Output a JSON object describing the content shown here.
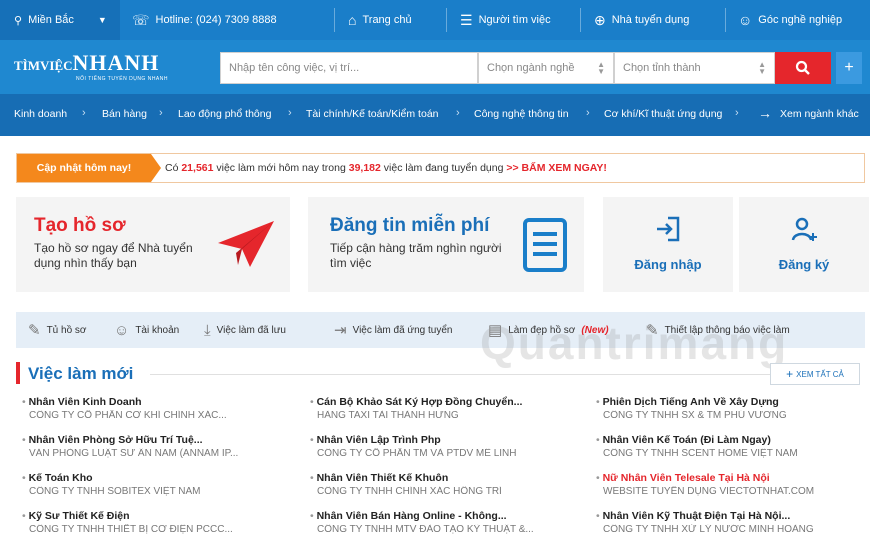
{
  "topbar": {
    "region": "Miền Bắc",
    "hotline": "Hotline: (024) 7309 8888",
    "home": "Trang chủ",
    "jobseeker": "Người tìm việc",
    "employer": "Nhà tuyển dụng",
    "career": "Góc nghề nghiệp"
  },
  "logo": {
    "text_a": "TÌMVIỆC",
    "text_b": "NHANH",
    "tagline": "NỐI TIẾNG TUYỂN DỤNG NHANH"
  },
  "search": {
    "keyword_placeholder": "Nhập tên công việc, vị trí...",
    "industry_placeholder": "Chọn ngành nghề",
    "city_placeholder": "Chọn tỉnh thành"
  },
  "categories": [
    "Kinh doanh",
    "Bán hàng",
    "Lao động phổ thông",
    "Tài chính/Kế toán/Kiểm toán",
    "Công nghệ thông tin",
    "Cơ khí/Kĩ thuật ứng dụng"
  ],
  "more_categories": "Xem ngành khác",
  "banner": {
    "tag": "Cập nhật hôm nay!",
    "t1": "Có ",
    "new_jobs": "21,561",
    "t2": " việc làm mới hôm nay trong ",
    "total_jobs": "39,182",
    "t3": " việc làm đang tuyển dụng ",
    "cta": ">> BẤM XEM NGAY!"
  },
  "cards": {
    "cv_title": "Tạo hồ sơ",
    "cv_sub": "Tạo hồ sơ ngay để Nhà tuyển dụng nhìn thấy bạn",
    "post_title": "Đăng tin miễn phí",
    "post_sub": "Tiếp cận hàng trăm nghìn người tìm việc",
    "login": "Đăng nhập",
    "register": "Đăng ký"
  },
  "tools": {
    "my_cv": "Tủ hồ sơ",
    "account": "Tài khoản",
    "saved": "Việc làm đã lưu",
    "applied": "Việc làm đã ứng tuyển",
    "beautify": "Làm đẹp hồ sơ",
    "beautify_new": "(New)",
    "alerts": "Thiết lập thông báo việc làm"
  },
  "watermark": "Quantrimang",
  "jobs_section": {
    "title": "Việc làm mới",
    "view_all": "XEM TẤT CẢ",
    "jobs": [
      {
        "title": "Nhân Viên Kinh Doanh",
        "company": "CÔNG TY CỔ PHẦN CƠ KHÍ CHÍNH XÁC..."
      },
      {
        "title": "Cán Bộ Khảo Sát Ký Hợp Đồng Chuyển...",
        "company": "HÃNG TAXI TÀI THÀNH HƯNG"
      },
      {
        "title": "Phiên Dịch Tiếng Anh Về Xây Dựng",
        "company": "CÔNG TY TNHH SX & TM PHÚ VƯƠNG"
      },
      {
        "title": "Nhân Viên Phòng Sở Hữu Trí Tuệ...",
        "company": "VĂN PHÒNG LUẬT SƯ ÂN NAM (ANNAM IP..."
      },
      {
        "title": "Nhân Viên Lập Trình Php",
        "company": "CÔNG TY CỔ PHẦN TM VÀ PTDV MÊ LINH"
      },
      {
        "title": "Nhân Viên Kế Toán (Đi Làm Ngay)",
        "company": "CÔNG TY TNHH SCENT HOME VIỆT NAM"
      },
      {
        "title": "Kế Toán Kho",
        "company": "CÔNG TY TNHH SOBITEX VIỆT NAM"
      },
      {
        "title": "Nhân Viên Thiết Kế Khuôn",
        "company": "CÔNG TY TNHH CHÍNH XÁC HỒNG TRÍ"
      },
      {
        "title": "Nữ Nhân Viên Telesale Tại Hà Nội",
        "company": "WEBSITE TUYỂN DỤNG VIECTOTNHAT.COM"
      },
      {
        "title": "Kỹ Sư Thiết Kế Điện",
        "company": "CÔNG TY TNHH THIẾT BỊ CƠ ĐIỆN PCCC..."
      },
      {
        "title": "Nhân Viên Bán Hàng Online - Không...",
        "company": "CÔNG TY TNHH MTV ĐÀO TẠO KỸ THUẬT &..."
      },
      {
        "title": "Nhân Viên Kỹ Thuật Điện Tại Hà Nội...",
        "company": "CÔNG TY TNHH XỬ LÝ NƯỚC MINH HOÀNG"
      }
    ]
  },
  "colors": {
    "primary_blue": "#1a7ec9",
    "accent_red": "#e5262c",
    "accent_orange": "#f4881c"
  }
}
